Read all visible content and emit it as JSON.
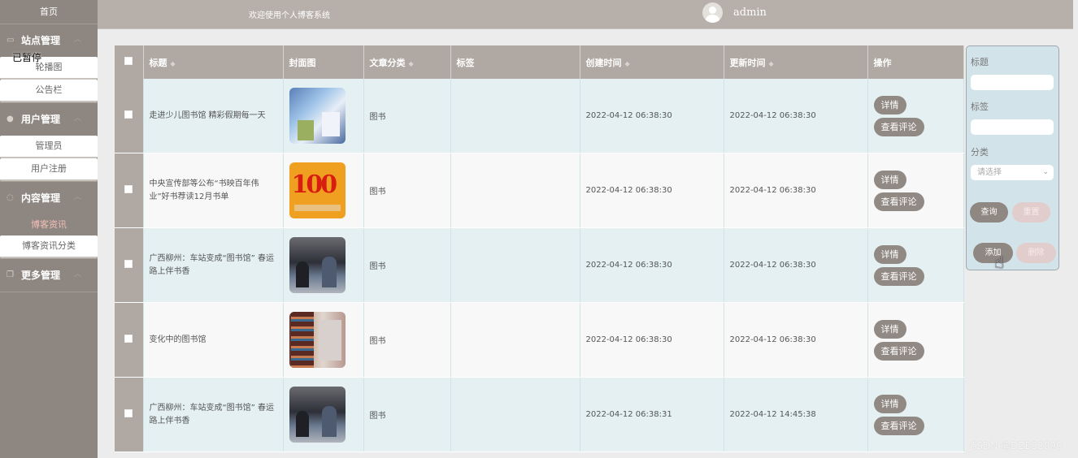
{
  "sidebar": {
    "home": "首页",
    "overlay_text": "已暂停",
    "groups": [
      {
        "label": "站点管理",
        "icon": "monitor-icon",
        "items": [
          "轮播图",
          "公告栏"
        ]
      },
      {
        "label": "用户管理",
        "icon": "user-icon",
        "items": [
          "管理员",
          "用户注册"
        ]
      },
      {
        "label": "内容管理",
        "icon": "chat-icon",
        "items": [
          "博客资讯",
          "博客资讯分类"
        ],
        "active_item": "博客资讯"
      },
      {
        "label": "更多管理",
        "icon": "copy-icon",
        "items": []
      }
    ]
  },
  "topbar": {
    "welcome": "欢迎使用个人博客系统",
    "user_name": "admin"
  },
  "table": {
    "headers": {
      "title": "标题",
      "cover": "封面图",
      "category": "文章分类",
      "tags": "标签",
      "created": "创建时间",
      "updated": "更新时间",
      "actions": "操作"
    },
    "rows": [
      {
        "title": "走进少儿图书馆 精彩假期每一天",
        "cover": "library-photo",
        "category": "图书",
        "tags": "",
        "created": "2022-04-12 06:38:30",
        "updated": "2022-04-12 06:38:30",
        "detail": "详情",
        "comments": "查看评论"
      },
      {
        "title": "中央宣传部等公布“书映百年伟业”好书荐读12月书单",
        "cover": "100-years-poster",
        "category": "图书",
        "tags": "",
        "created": "2022-04-12 06:38:30",
        "updated": "2022-04-12 06:38:30",
        "detail": "详情",
        "comments": "查看评论"
      },
      {
        "title": "广西柳州：车站变成“图书馆” 春运路上伴书香",
        "cover": "station-photo",
        "category": "图书",
        "tags": "",
        "created": "2022-04-12 06:38:30",
        "updated": "2022-04-12 06:38:30",
        "detail": "详情",
        "comments": "查看评论"
      },
      {
        "title": "变化中的图书馆",
        "cover": "bookshelf-photo",
        "category": "图书",
        "tags": "",
        "created": "2022-04-12 06:38:30",
        "updated": "2022-04-12 06:38:30",
        "detail": "详情",
        "comments": "查看评论"
      },
      {
        "title": "广西柳州：车站变成“图书馆” 春运路上伴书香",
        "cover": "station-photo",
        "category": "图书",
        "tags": "",
        "created": "2022-04-12 06:38:31",
        "updated": "2022-04-12 14:45:38",
        "detail": "详情",
        "comments": "查看评论"
      }
    ]
  },
  "panel": {
    "title_label": "标题",
    "tags_label": "标签",
    "category_label": "分类",
    "category_placeholder": "请选择",
    "search": "查询",
    "reset": "重置",
    "add": "添加",
    "delete": "删除"
  },
  "watermark": "CSDN @DZBS2000"
}
